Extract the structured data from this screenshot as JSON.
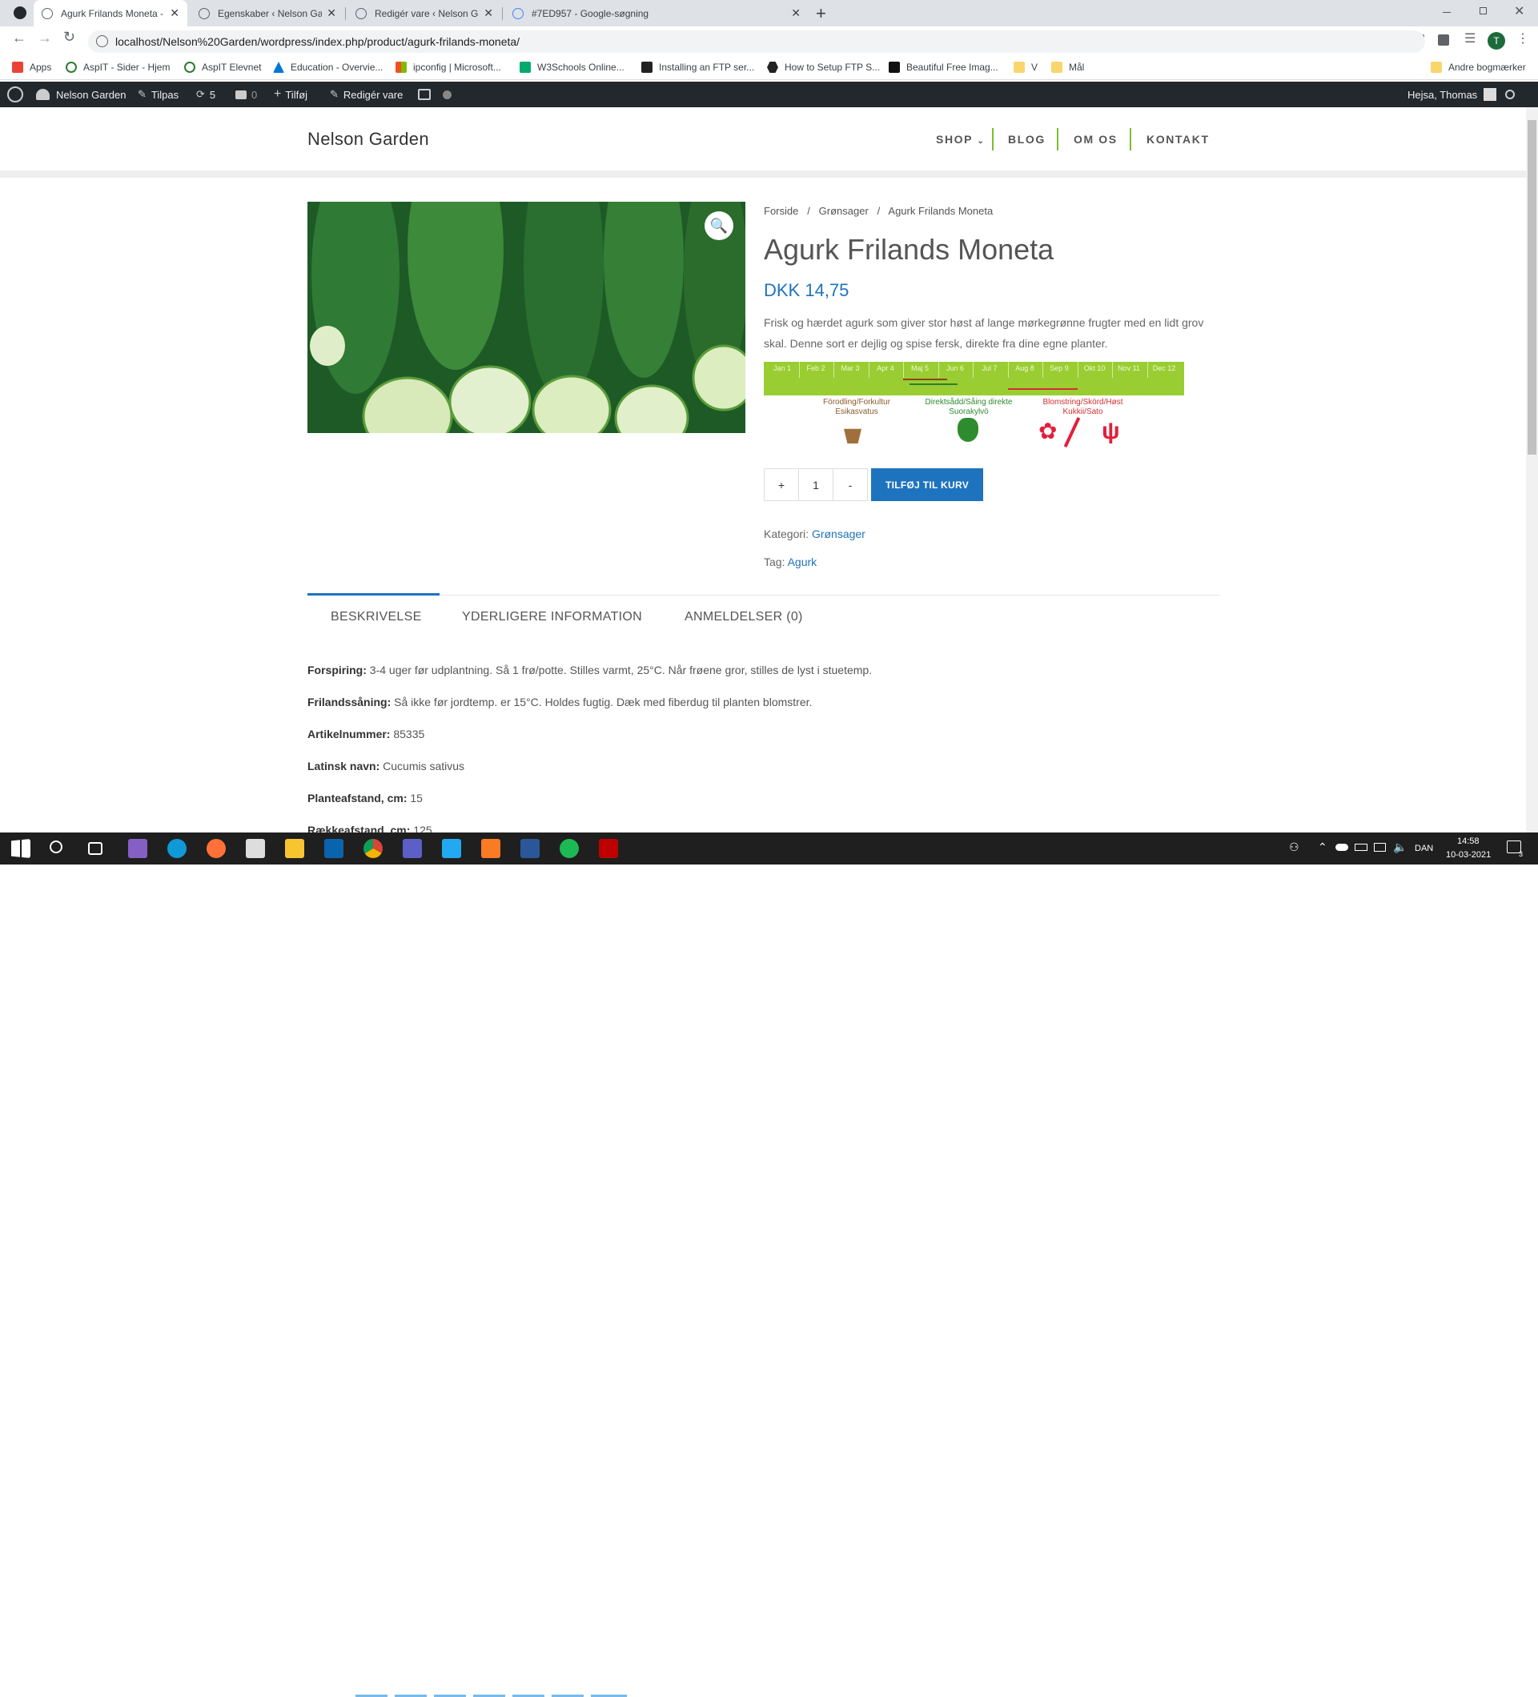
{
  "browser": {
    "tabs": [
      {
        "title": "Agurk Frilands Moneta - Nelson"
      },
      {
        "title": "Egenskaber ‹ Nelson Garden — V"
      },
      {
        "title": "Redigér vare ‹ Nelson Garden —"
      },
      {
        "title": "#7ED957 - Google-søgning"
      }
    ],
    "new_tab": "+",
    "url": "localhost/Nelson%20Garden/wordpress/index.php/product/agurk-frilands-moneta/",
    "profile_initial": "T",
    "bookmarks": [
      {
        "label": "Apps"
      },
      {
        "label": "AspIT - Sider - Hjem"
      },
      {
        "label": "AspIT Elevnet"
      },
      {
        "label": "Education - Overvie..."
      },
      {
        "label": "ipconfig | Microsoft..."
      },
      {
        "label": "W3Schools Online..."
      },
      {
        "label": "Installing an FTP ser..."
      },
      {
        "label": "How to Setup FTP S..."
      },
      {
        "label": "Beautiful Free Imag..."
      },
      {
        "label": "V"
      },
      {
        "label": "Mål"
      }
    ],
    "other_bookmarks": "Andre bogmærker"
  },
  "wpbar": {
    "site": "Nelson Garden",
    "customize": "Tilpas",
    "updates": "5",
    "comments": "0",
    "add_new": "Tilføj",
    "edit_product": "Redigér vare",
    "greeting": "Hejsa, Thomas"
  },
  "site": {
    "title": "Nelson Garden",
    "nav": [
      "SHOP",
      "BLOG",
      "OM OS",
      "KONTAKT"
    ]
  },
  "product": {
    "breadcrumb": [
      "Forside",
      "/",
      "Grønsager",
      "/",
      "Agurk Frilands Moneta"
    ],
    "title": "Agurk Frilands Moneta",
    "price": "DKK 14,75",
    "description": "Frisk og hærdet agurk som giver stor høst af lange mørkegrønne frugter med en lidt grov skal. Denne sort er dejlig og spise fersk, direkte fra dine egne planter.",
    "calendar": {
      "months": [
        "Jan 1",
        "Feb 2",
        "Mar 3",
        "Apr 4",
        "Maj 5",
        "Jun 6",
        "Jul 7",
        "Aug 8",
        "Sep 9",
        "Okt 10",
        "Nov 11",
        "Dec 12"
      ],
      "label_1": "Förodling/Forkultur",
      "label_1b": "Esikasvatus",
      "label_2": "Direktsådd/Såing direkte",
      "label_2b": "Suorakylvö",
      "label_3": "Blomstring/Skörd/Høst",
      "label_3b": "Kukkii/Sato"
    },
    "qty_plus": "+",
    "qty_value": "1",
    "qty_minus": "-",
    "add_to_cart": "TILFØJ TIL KURV",
    "category_label": "Kategori:",
    "category": "Grønsager",
    "tag_label": "Tag:",
    "tag": "Agurk",
    "tabs": [
      "BESKRIVELSE",
      "YDERLIGERE INFORMATION",
      "ANMELDELSER (0)"
    ],
    "details": [
      {
        "label": "Forspiring:",
        "value": " 3-4 uger før udplantning. Så 1 frø/potte. Stilles varmt, 25°C. Når frøene gror, stilles de lyst i stuetemp."
      },
      {
        "label": "Frilandssåning:",
        "value": " Så ikke før jordtemp. er 15°C. Holdes fugtig. Dæk med fiberdug til planten blomstrer."
      },
      {
        "label": "Artikelnummer:",
        "value": " 85335"
      },
      {
        "label": "Latinsk navn:",
        "value": " Cucumis sativus"
      },
      {
        "label": "Planteafstand, cm:",
        "value": " 15"
      },
      {
        "label": "Rækkeafstand, cm:",
        "value": " 125"
      }
    ]
  },
  "taskbar": {
    "language": "DAN",
    "time": "14:58",
    "date": "10-03-2021",
    "notifications": "3"
  },
  "colors": {
    "accent": "#1e73be",
    "nav_separator": "#7fbc2a",
    "calendar_green": "#9acd32",
    "wpbar": "#23282d"
  }
}
